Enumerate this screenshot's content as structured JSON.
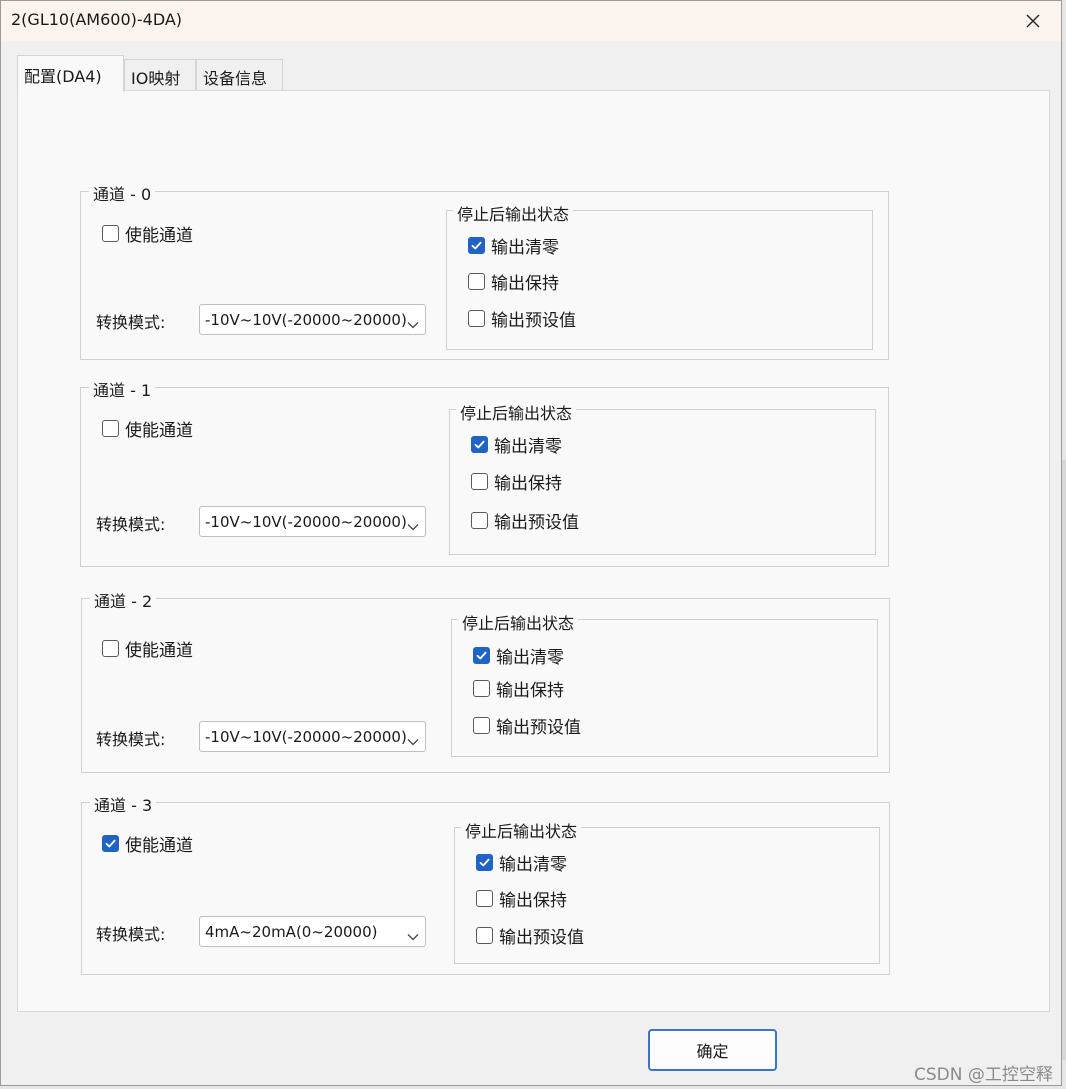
{
  "window": {
    "title": "2(GL10(AM600)-4DA)"
  },
  "tabs": [
    {
      "label": "配置(DA4)"
    },
    {
      "label": "IO映射"
    },
    {
      "label": "设备信息"
    }
  ],
  "channels": [
    {
      "title": "通道 - 0",
      "enable": {
        "label": "使能通道",
        "checked": false
      },
      "mode_label": "转换模式:",
      "mode_value": "-10V~10V(-20000~20000)",
      "stop_group_title": "停止后输出状态",
      "stop_options": [
        {
          "label": "输出清零",
          "checked": true
        },
        {
          "label": "输出保持",
          "checked": false
        },
        {
          "label": "输出预设值",
          "checked": false
        }
      ]
    },
    {
      "title": "通道 - 1",
      "enable": {
        "label": "使能通道",
        "checked": false
      },
      "mode_label": "转换模式:",
      "mode_value": "-10V~10V(-20000~20000)",
      "stop_group_title": "停止后输出状态",
      "stop_options": [
        {
          "label": "输出清零",
          "checked": true
        },
        {
          "label": "输出保持",
          "checked": false
        },
        {
          "label": "输出预设值",
          "checked": false
        }
      ]
    },
    {
      "title": "通道 - 2",
      "enable": {
        "label": "使能通道",
        "checked": false
      },
      "mode_label": "转换模式:",
      "mode_value": "-10V~10V(-20000~20000)",
      "stop_group_title": "停止后输出状态",
      "stop_options": [
        {
          "label": "输出清零",
          "checked": true
        },
        {
          "label": "输出保持",
          "checked": false
        },
        {
          "label": "输出预设值",
          "checked": false
        }
      ]
    },
    {
      "title": "通道 - 3",
      "enable": {
        "label": "使能通道",
        "checked": true
      },
      "mode_label": "转换模式:",
      "mode_value": "4mA~20mA(0~20000)",
      "stop_group_title": "停止后输出状态",
      "stop_options": [
        {
          "label": "输出清零",
          "checked": true
        },
        {
          "label": "输出保持",
          "checked": false
        },
        {
          "label": "输出预设值",
          "checked": false
        }
      ]
    }
  ],
  "footer": {
    "ok_label": "确定"
  },
  "watermark": "CSDN @工控空释",
  "colors": {
    "accent": "#1f63c4",
    "titlebar": "#fbf4ee",
    "panel": "#f9f9f9"
  },
  "icons": {
    "close": "close-icon",
    "dropdown": "chevron-down-icon",
    "check": "checkmark-icon"
  }
}
